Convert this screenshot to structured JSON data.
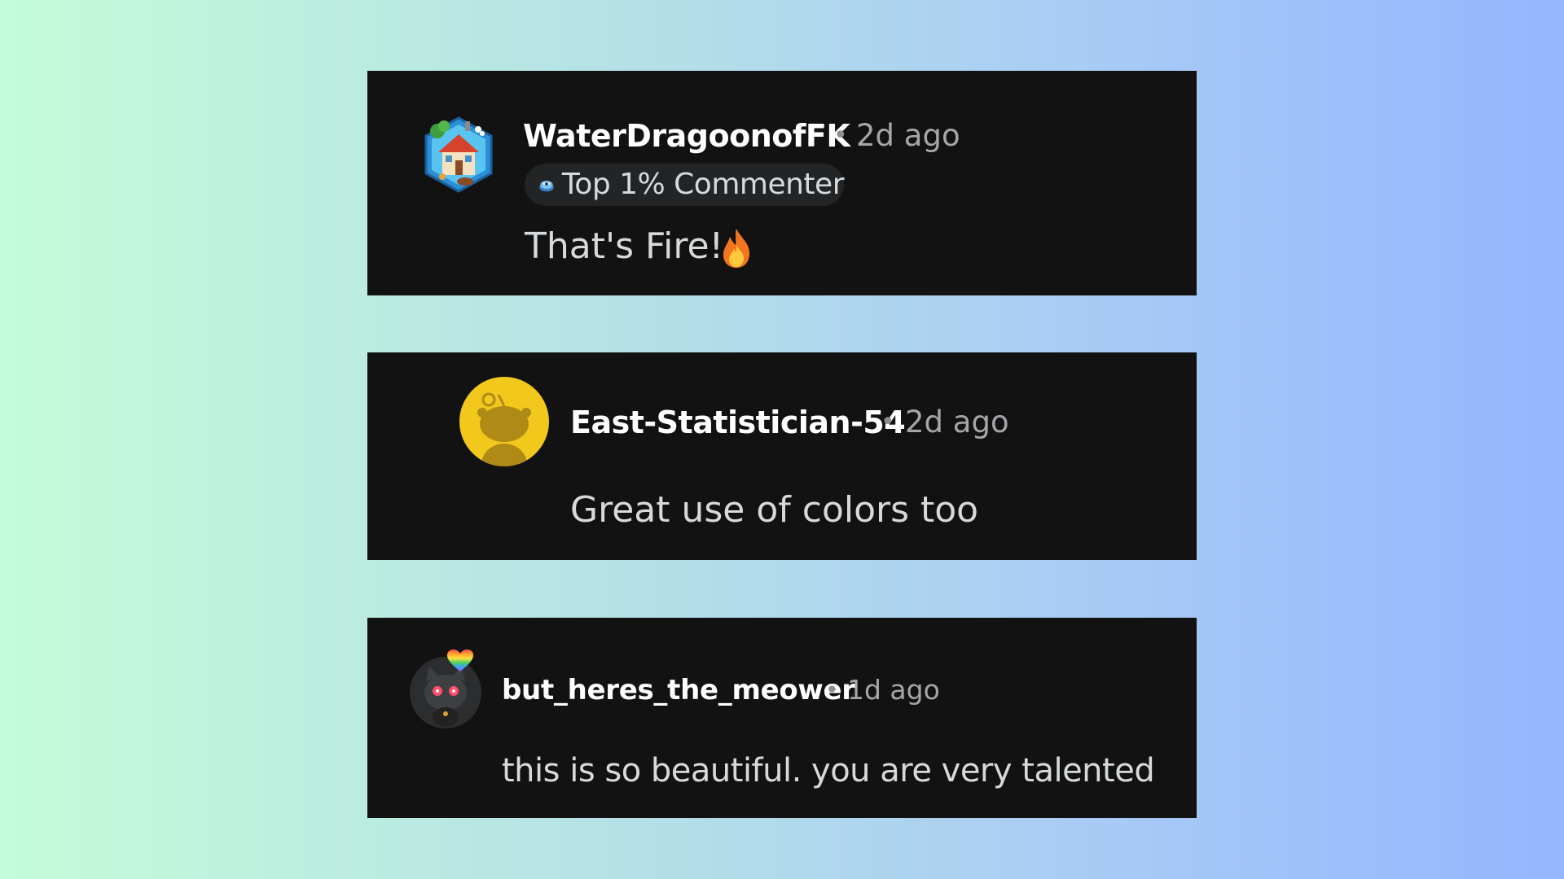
{
  "comments": [
    {
      "username": "WaterDragoonofFK",
      "separator": "•",
      "time": "2d ago",
      "badge": {
        "icon": "commenter-badge-icon",
        "label": "Top 1% Commenter"
      },
      "avatar": "house-hexagon-avatar-icon",
      "body": "That's Fire!",
      "emoji": "fire-emoji-icon"
    },
    {
      "username": "East-Statistician-54",
      "separator": "•",
      "time": "2d ago",
      "avatar": "snoo-default-avatar-icon",
      "body": "Great use of colors too"
    },
    {
      "username": "but_heres_the_meower",
      "separator": "•",
      "time": "1d ago",
      "avatar": "cat-avatar-icon",
      "avatar_accessory": "rainbow-heart-icon",
      "body": "this is so beautiful. you are very talented"
    }
  ],
  "colors": {
    "card_background": "#121213",
    "username": "#ffffff",
    "meta": "#a4a6a9",
    "body": "#d7dadc",
    "snoo_yellow": "#f2c81c"
  }
}
